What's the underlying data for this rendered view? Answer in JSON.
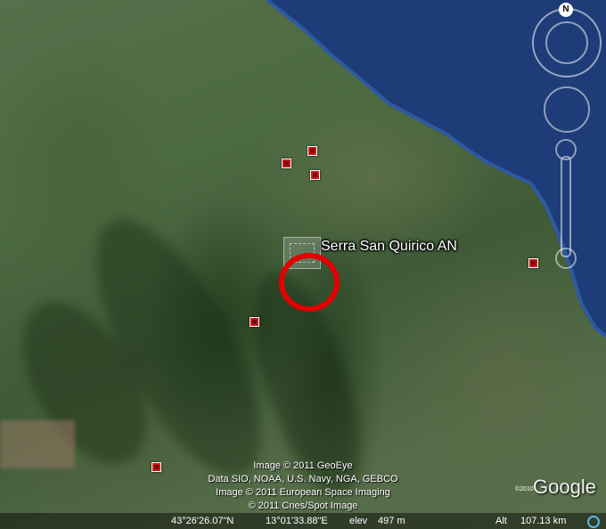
{
  "map": {
    "placemark": {
      "label": "Serra San Quirico AN",
      "highlight_color": "#e30000"
    },
    "marker_color": "#c81a1a",
    "sea_color": "#1e3c78"
  },
  "navigation": {
    "north_label": "N"
  },
  "attribution": {
    "line1": "Image © 2011 GeoEye",
    "line2": "Data SIO, NOAA, U.S. Navy, NGA, GEBCO",
    "line3": "Image © 2011 European Space Imaging",
    "line4": "© 2011 Cnes/Spot Image"
  },
  "logo": {
    "year": "©2010",
    "text": "Google"
  },
  "status_bar": {
    "latitude": "43°26'26.07\"N",
    "longitude": "13°01'33.88\"E",
    "elevation_label": "elev",
    "elevation_value": "497 m",
    "altitude_label": "Alt",
    "altitude_value": "107.13 km"
  }
}
